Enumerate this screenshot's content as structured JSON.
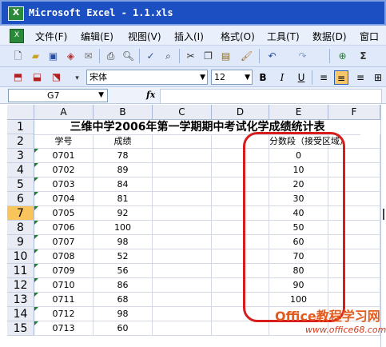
{
  "window": {
    "title": "Microsoft Excel - 1.1.xls",
    "app_icon_letter": "X"
  },
  "menu": {
    "items": [
      "文件(F)",
      "编辑(E)",
      "视图(V)",
      "插入(I)",
      "格式(O)",
      "工具(T)",
      "数据(D)",
      "窗口"
    ]
  },
  "toolbar": {
    "icons": [
      "new-icon",
      "open-icon",
      "save-icon",
      "permission-icon",
      "email-icon",
      "print-icon",
      "print-preview-icon",
      "spelling-icon",
      "research-icon",
      "cut-icon",
      "copy-icon",
      "paste-icon",
      "format-painter-icon",
      "undo-icon",
      "redo-icon",
      "hyperlink-icon",
      "autosum-icon"
    ]
  },
  "format_toolbar": {
    "font_name": "宋体",
    "font_size": "12",
    "bold": "B",
    "italic": "I",
    "underline": "U"
  },
  "formula_bar": {
    "name_box": "G7",
    "fx": "fx",
    "content": ""
  },
  "columns": [
    "A",
    "B",
    "C",
    "D",
    "E",
    "F"
  ],
  "selected_row": "7",
  "sheet": {
    "title": "三维中学2006年第一学期期中考试化学成绩统计表",
    "header": {
      "a": "学号",
      "b": "成绩",
      "e": "分数段（接受区域）"
    },
    "rows": [
      {
        "num": "1"
      },
      {
        "num": "2"
      },
      {
        "num": "3",
        "a": "0701",
        "b": "78",
        "e": "0"
      },
      {
        "num": "4",
        "a": "0702",
        "b": "89",
        "e": "10"
      },
      {
        "num": "5",
        "a": "0703",
        "b": "84",
        "e": "20"
      },
      {
        "num": "6",
        "a": "0704",
        "b": "81",
        "e": "30"
      },
      {
        "num": "7",
        "a": "0705",
        "b": "92",
        "e": "40"
      },
      {
        "num": "8",
        "a": "0706",
        "b": "100",
        "e": "50"
      },
      {
        "num": "9",
        "a": "0707",
        "b": "98",
        "e": "60"
      },
      {
        "num": "10",
        "a": "0708",
        "b": "52",
        "e": "70"
      },
      {
        "num": "11",
        "a": "0709",
        "b": "56",
        "e": "80"
      },
      {
        "num": "12",
        "a": "0710",
        "b": "86",
        "e": "90"
      },
      {
        "num": "13",
        "a": "0711",
        "b": "68",
        "e": "100"
      },
      {
        "num": "14",
        "a": "0712",
        "b": "98"
      },
      {
        "num": "15",
        "a": "0713",
        "b": "60"
      }
    ]
  },
  "watermark": {
    "title": "Office教程学习网",
    "url": "www.office68.com"
  },
  "colors": {
    "titlebar": "#1c4fc2",
    "highlight": "#d71d1d",
    "selected_row": "#f9c45c",
    "watermark": "#e45b1e"
  }
}
